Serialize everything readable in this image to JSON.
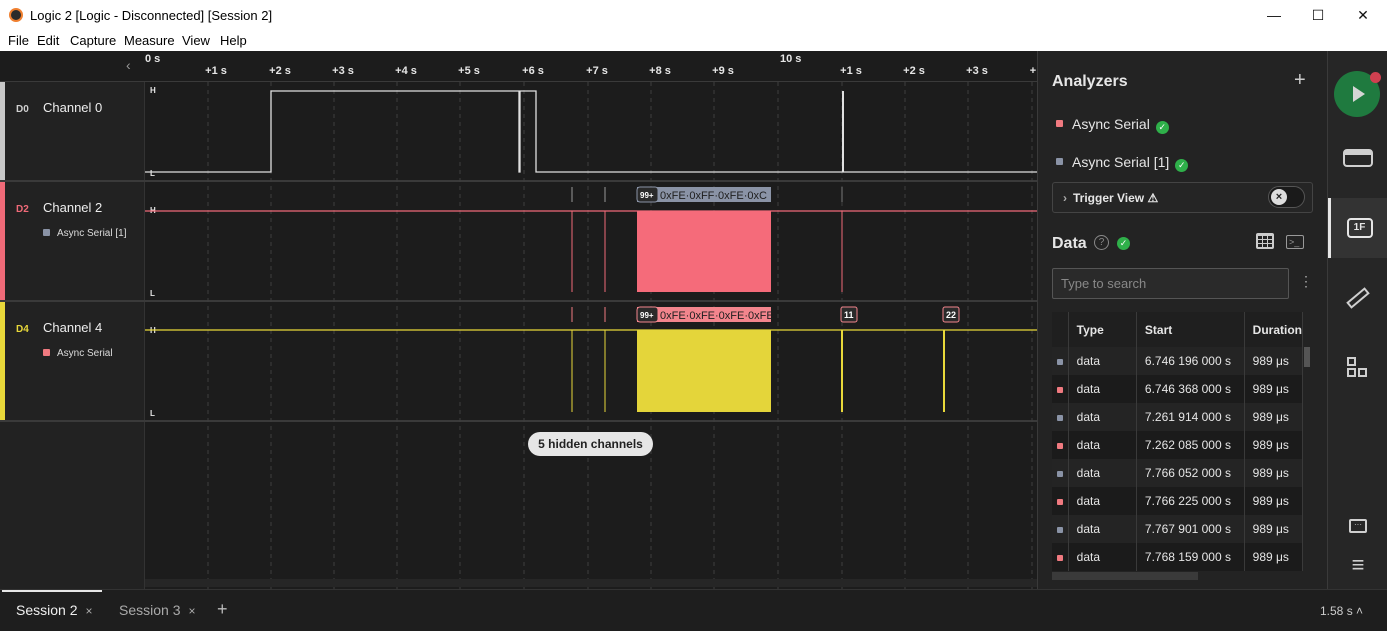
{
  "window": {
    "title": "Logic 2 [Logic - Disconnected] [Session 2]",
    "minimize": "—",
    "maximize": "☐",
    "close": "✕"
  },
  "menu": [
    "File",
    "Edit",
    "Capture",
    "Measure",
    "View",
    "Help"
  ],
  "ruler": {
    "start_label": "0 s",
    "labels": [
      "+1 s",
      "+2 s",
      "+3 s",
      "+4 s",
      "+5 s",
      "+6 s",
      "+7 s",
      "+8 s",
      "+9 s",
      "10 s",
      "+1 s",
      "+2 s",
      "+3 s",
      "+"
    ]
  },
  "channels": [
    {
      "id": "D0",
      "name": "Channel 0",
      "color": "#c8c8c8",
      "analyzer": "",
      "analyzer_color": ""
    },
    {
      "id": "D2",
      "name": "Channel 2",
      "color": "#f06a78",
      "analyzer": "Async Serial [1]",
      "analyzer_color": "#8a93a6"
    },
    {
      "id": "D4",
      "name": "Channel 4",
      "color": "#e8d83a",
      "analyzer": "Async Serial",
      "analyzer_color": "#f07a80"
    }
  ],
  "levels": {
    "high": "H",
    "low": "L"
  },
  "decoded": {
    "ch2_burst": "0xFE·0xFF·0xFE·0xC",
    "ch4_burst": "0xFE·0xFE·0xFE·0xFE",
    "badge": "99+",
    "ch4_label_a": "11",
    "ch4_label_b": "22"
  },
  "hidden_channels": "5 hidden channels",
  "tabs": [
    {
      "label": "Session 2",
      "close": "×"
    },
    {
      "label": "Session 3",
      "close": "×"
    }
  ],
  "add_tab": "+",
  "zoom_readout": "1.58 s",
  "panel": {
    "analyzers_title": "Analyzers",
    "add": "+",
    "analyzers": [
      {
        "name": "Async Serial",
        "color": "#f07a80"
      },
      {
        "name": "Async Serial [1]",
        "color": "#8a93a6"
      }
    ],
    "trigger_view": "Trigger View",
    "data_title": "Data",
    "search_placeholder": "Type to search",
    "columns": [
      "Type",
      "Start",
      "Duration"
    ],
    "rows": [
      {
        "color": "#8a93a6",
        "type": "data",
        "start": "6.746 196 000 s",
        "duration": "989 μs"
      },
      {
        "color": "#f07a80",
        "type": "data",
        "start": "6.746 368 000 s",
        "duration": "989 μs"
      },
      {
        "color": "#8a93a6",
        "type": "data",
        "start": "7.261 914 000 s",
        "duration": "989 μs"
      },
      {
        "color": "#f07a80",
        "type": "data",
        "start": "7.262 085 000 s",
        "duration": "989 μs"
      },
      {
        "color": "#8a93a6",
        "type": "data",
        "start": "7.766 052 000 s",
        "duration": "989 μs"
      },
      {
        "color": "#f07a80",
        "type": "data",
        "start": "7.766 225 000 s",
        "duration": "989 μs"
      },
      {
        "color": "#8a93a6",
        "type": "data",
        "start": "7.767 901 000 s",
        "duration": "989 μs"
      },
      {
        "color": "#f07a80",
        "type": "data",
        "start": "7.768 159 000 s",
        "duration": "989 μs"
      }
    ]
  },
  "sidebar": {
    "analyzers_icon_label": "1F"
  }
}
